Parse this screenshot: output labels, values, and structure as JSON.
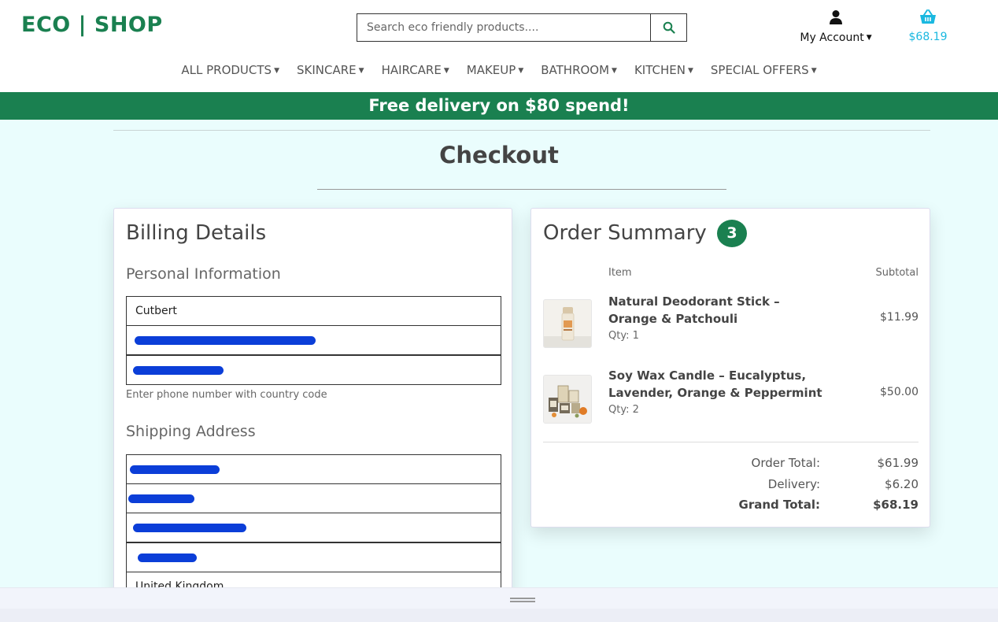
{
  "header": {
    "logo": "ECO | SHOP",
    "search_placeholder": "Search eco friendly products....",
    "account_label": "My Account",
    "cart_amount": "$68.19"
  },
  "nav": {
    "items": [
      {
        "label": "ALL PRODUCTS"
      },
      {
        "label": "SKINCARE"
      },
      {
        "label": "HAIRCARE"
      },
      {
        "label": "MAKEUP"
      },
      {
        "label": "BATHROOM"
      },
      {
        "label": "KITCHEN"
      },
      {
        "label": "SPECIAL OFFERS"
      }
    ]
  },
  "banner": {
    "text": "Free delivery on $80 spend!"
  },
  "page": {
    "title": "Checkout"
  },
  "billing": {
    "title": "Billing Details",
    "personal_label": "Personal Information",
    "name_value": "Cutbert",
    "phone_help": "Enter phone number with country code",
    "shipping_label": "Shipping Address",
    "country_value": "United Kingdom"
  },
  "summary": {
    "title": "Order Summary",
    "count": "3",
    "col_item": "Item",
    "col_subtotal": "Subtotal",
    "items": [
      {
        "name": "Natural Deodorant Stick – Orange & Patchouli",
        "qty": "Qty: 1",
        "price": "$11.99"
      },
      {
        "name": "Soy Wax Candle – Eucalyptus, Lavender, Orange & Peppermint",
        "qty": "Qty: 2",
        "price": "$50.00"
      }
    ],
    "order_total_label": "Order Total:",
    "order_total": "$61.99",
    "delivery_label": "Delivery:",
    "delivery": "$6.20",
    "grand_total_label": "Grand Total:",
    "grand_total": "$68.19"
  },
  "colors": {
    "brand_green": "#1a8050",
    "cart_blue": "#1ab8e0",
    "redaction_blue": "#0b3ed8"
  }
}
